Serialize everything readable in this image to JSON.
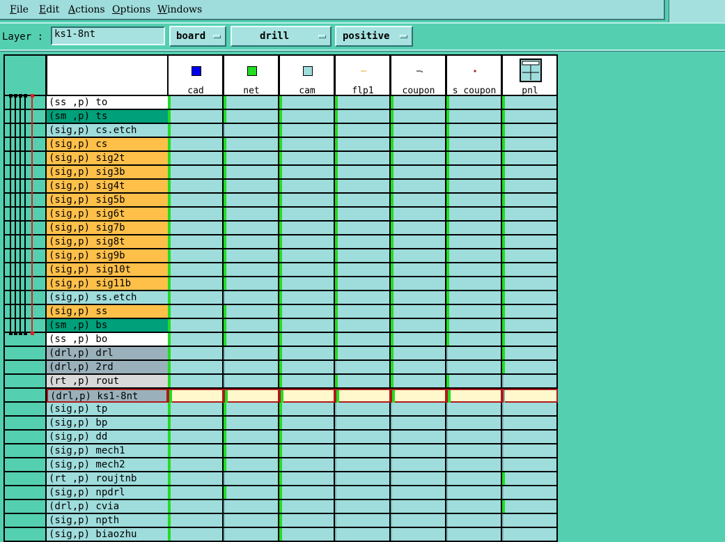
{
  "menu": {
    "items": [
      {
        "mnemonic": "F",
        "rest": "ile"
      },
      {
        "mnemonic": "E",
        "rest": "dit"
      },
      {
        "mnemonic": "A",
        "rest": "ctions"
      },
      {
        "mnemonic": "O",
        "rest": "ptions"
      },
      {
        "mnemonic": "W",
        "rest": "indows"
      }
    ]
  },
  "layer_bar": {
    "label": "Layer :",
    "value": "ks1-8nt",
    "opt_context": "board",
    "opt_type": "drill",
    "opt_polarity": "positive"
  },
  "columns": [
    {
      "label": "cad",
      "icon": "blue-square-icon"
    },
    {
      "label": "net",
      "icon": "green-square-icon"
    },
    {
      "label": "cam",
      "icon": "cyan-square-icon"
    },
    {
      "label": "flp1",
      "icon": "orange-dash-icon"
    },
    {
      "label": "coupon",
      "icon": "coupon-icon"
    },
    {
      "label": "s_coupon",
      "icon": "dot-icon"
    },
    {
      "label": "pnl",
      "icon": "panel-icon"
    }
  ],
  "layers": [
    {
      "type": "(ss ,p)",
      "name": "to",
      "color": "#ffffff"
    },
    {
      "type": "(sm ,p)",
      "name": "ts",
      "color": "#00a07a"
    },
    {
      "type": "(sig,p)",
      "name": "cs.etch",
      "color": "#9fdcdc"
    },
    {
      "type": "(sig,p)",
      "name": "cs",
      "color": "#ffc04a"
    },
    {
      "type": "(sig,p)",
      "name": "sig2t",
      "color": "#ffc04a"
    },
    {
      "type": "(sig,p)",
      "name": "sig3b",
      "color": "#ffc04a"
    },
    {
      "type": "(sig,p)",
      "name": "sig4t",
      "color": "#ffc04a"
    },
    {
      "type": "(sig,p)",
      "name": "sig5b",
      "color": "#ffc04a"
    },
    {
      "type": "(sig,p)",
      "name": "sig6t",
      "color": "#ffc04a"
    },
    {
      "type": "(sig,p)",
      "name": "sig7b",
      "color": "#ffc04a"
    },
    {
      "type": "(sig,p)",
      "name": "sig8t",
      "color": "#ffc04a"
    },
    {
      "type": "(sig,p)",
      "name": "sig9b",
      "color": "#ffc04a"
    },
    {
      "type": "(sig,p)",
      "name": "sig10t",
      "color": "#ffc04a"
    },
    {
      "type": "(sig,p)",
      "name": "sig11b",
      "color": "#ffc04a"
    },
    {
      "type": "(sig,p)",
      "name": "ss.etch",
      "color": "#9fdcdc"
    },
    {
      "type": "(sig,p)",
      "name": "ss",
      "color": "#ffc04a"
    },
    {
      "type": "(sm ,p)",
      "name": "bs",
      "color": "#00a07a"
    },
    {
      "type": "(ss ,p)",
      "name": "bo",
      "color": "#ffffff"
    },
    {
      "type": "(drl,p)",
      "name": "drl",
      "color": "#9ab1bb"
    },
    {
      "type": "(drl,p)",
      "name": "2rd",
      "color": "#9ab1bb"
    },
    {
      "type": "(rt ,p)",
      "name": "rout",
      "color": "#d8d8d8"
    },
    {
      "type": "(drl,p)",
      "name": "ks1-8nt",
      "color": "#9ab1bb",
      "selected": true
    },
    {
      "type": "(sig,p)",
      "name": "tp",
      "color": "#9fdcdc"
    },
    {
      "type": "(sig,p)",
      "name": "bp",
      "color": "#9fdcdc"
    },
    {
      "type": "(sig,p)",
      "name": "dd",
      "color": "#9fdcdc"
    },
    {
      "type": "(sig,p)",
      "name": "mech1",
      "color": "#9fdcdc"
    },
    {
      "type": "(sig,p)",
      "name": "mech2",
      "color": "#9fdcdc"
    },
    {
      "type": "(rt ,p)",
      "name": "roujtnb",
      "color": "#9fdcdc"
    },
    {
      "type": "(sig,p)",
      "name": "npdrl",
      "color": "#9fdcdc"
    },
    {
      "type": "(drl,p)",
      "name": "cvia",
      "color": "#9fdcdc"
    },
    {
      "type": "(sig,p)",
      "name": "npth",
      "color": "#9fdcdc"
    },
    {
      "type": "(sig,p)",
      "name": "biaozhu",
      "color": "#9fdcdc"
    }
  ],
  "markers": [
    [
      1,
      1,
      1,
      1,
      1,
      1,
      1
    ],
    [
      1,
      1,
      1,
      1,
      1,
      1,
      1
    ],
    [
      1,
      0,
      1,
      1,
      1,
      1,
      1
    ],
    [
      1,
      1,
      1,
      1,
      1,
      1,
      1
    ],
    [
      1,
      1,
      1,
      1,
      1,
      1,
      1
    ],
    [
      1,
      1,
      1,
      1,
      1,
      1,
      1
    ],
    [
      1,
      1,
      1,
      1,
      1,
      1,
      1
    ],
    [
      1,
      1,
      1,
      1,
      1,
      1,
      1
    ],
    [
      1,
      1,
      1,
      1,
      1,
      1,
      1
    ],
    [
      1,
      1,
      1,
      1,
      1,
      1,
      1
    ],
    [
      1,
      1,
      1,
      1,
      1,
      1,
      1
    ],
    [
      1,
      1,
      1,
      1,
      1,
      1,
      1
    ],
    [
      1,
      1,
      1,
      1,
      1,
      1,
      1
    ],
    [
      1,
      1,
      1,
      1,
      1,
      1,
      1
    ],
    [
      1,
      0,
      1,
      1,
      1,
      1,
      1
    ],
    [
      1,
      1,
      1,
      1,
      1,
      1,
      1
    ],
    [
      1,
      1,
      1,
      1,
      1,
      1,
      1
    ],
    [
      1,
      1,
      1,
      1,
      1,
      1,
      1
    ],
    [
      1,
      0,
      1,
      1,
      1,
      0,
      1
    ],
    [
      1,
      0,
      1,
      0,
      1,
      0,
      1
    ],
    [
      1,
      0,
      1,
      1,
      1,
      1,
      0
    ],
    [
      1,
      1,
      1,
      1,
      1,
      1,
      0
    ],
    [
      1,
      1,
      1,
      0,
      0,
      0,
      0
    ],
    [
      1,
      1,
      1,
      0,
      0,
      0,
      0
    ],
    [
      1,
      1,
      1,
      0,
      0,
      0,
      0
    ],
    [
      1,
      1,
      1,
      0,
      0,
      0,
      0
    ],
    [
      1,
      1,
      1,
      0,
      0,
      0,
      0
    ],
    [
      1,
      0,
      1,
      0,
      0,
      0,
      1
    ],
    [
      1,
      1,
      1,
      0,
      0,
      0,
      0
    ],
    [
      1,
      0,
      1,
      0,
      0,
      0,
      1
    ],
    [
      1,
      0,
      1,
      0,
      0,
      0,
      0
    ],
    [
      1,
      0,
      1,
      0,
      0,
      0,
      0
    ]
  ]
}
